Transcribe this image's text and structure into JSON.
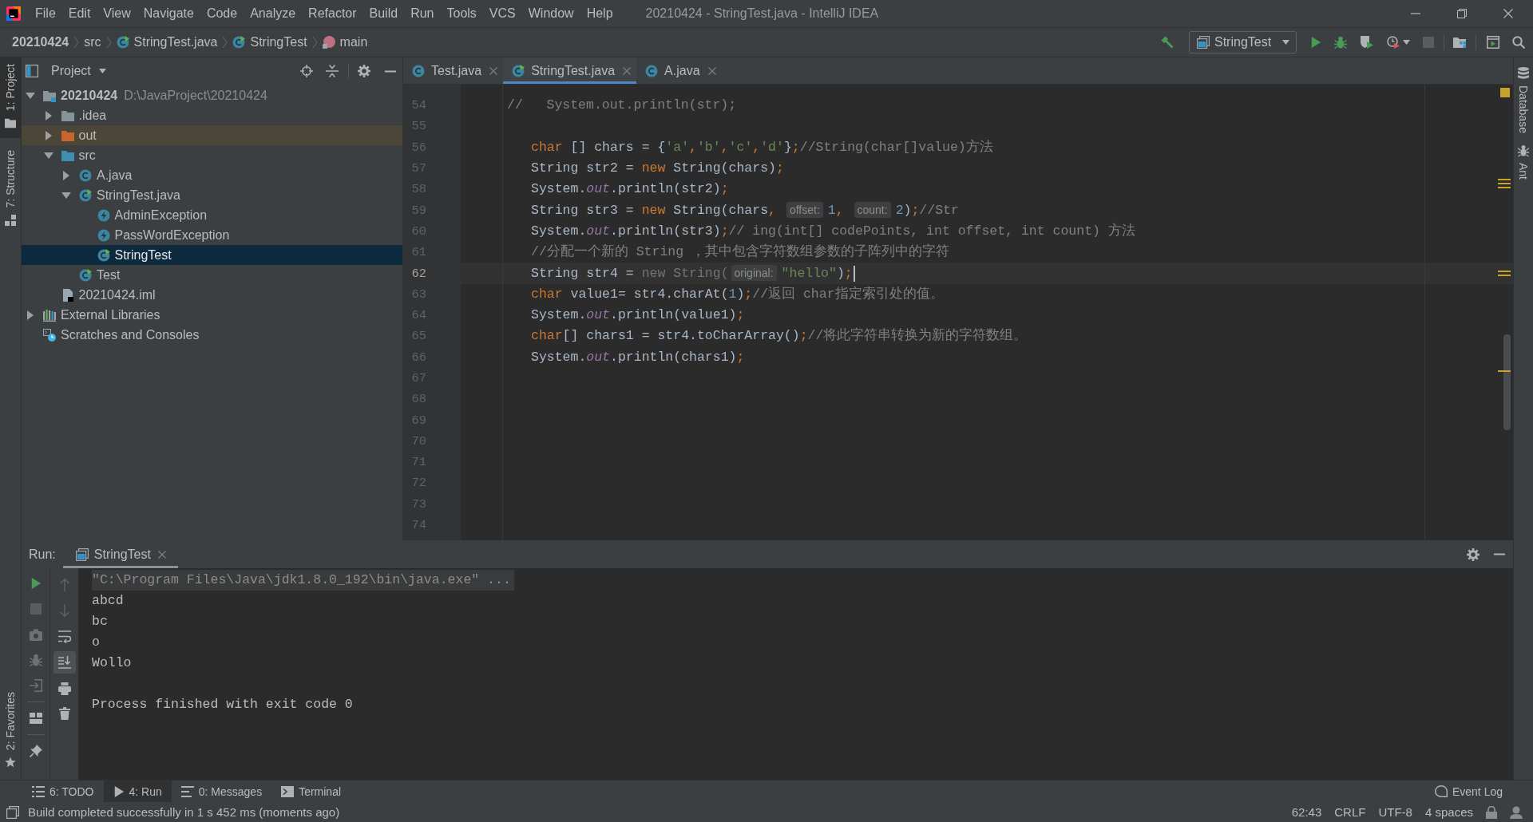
{
  "window": {
    "title": "20210424 - StringTest.java - IntelliJ IDEA"
  },
  "menu": [
    "File",
    "Edit",
    "View",
    "Navigate",
    "Code",
    "Analyze",
    "Refactor",
    "Build",
    "Run",
    "Tools",
    "VCS",
    "Window",
    "Help"
  ],
  "breadcrumbs": [
    {
      "label": "20210424",
      "kind": "project"
    },
    {
      "label": "src",
      "kind": "folder"
    },
    {
      "label": "StringTest.java",
      "kind": "runnable_class"
    },
    {
      "label": "StringTest",
      "kind": "runnable_class"
    },
    {
      "label": "main",
      "kind": "method"
    }
  ],
  "toolbar": {
    "run_configuration": "StringTest"
  },
  "left_stripe": {
    "top": [
      {
        "label": "1: Project",
        "kind": "project",
        "selected": true
      },
      {
        "label": "7: Structure",
        "kind": "structure",
        "selected": false
      }
    ],
    "bottom": [
      {
        "label": "2: Favorites",
        "kind": "favorites",
        "selected": false
      }
    ]
  },
  "right_stripe": [
    {
      "label": "Database",
      "kind": "database"
    },
    {
      "label": "Ant",
      "kind": "ant"
    }
  ],
  "project_panel": {
    "title": "Project",
    "tree": [
      {
        "label": "20210424",
        "path": "D:\\JavaProject\\20210424",
        "kind": "module",
        "expanded": true,
        "selected": false,
        "children": [
          {
            "label": ".idea",
            "kind": "folder",
            "expanded": false,
            "selected": false
          },
          {
            "label": "out",
            "kind": "excluded_folder",
            "expanded": false,
            "selected": false
          },
          {
            "label": "src",
            "kind": "source_folder",
            "expanded": true,
            "selected": false,
            "children": [
              {
                "label": "A.java",
                "kind": "class",
                "expanded": false,
                "selected": false
              },
              {
                "label": "StringTest.java",
                "kind": "runnable_class",
                "expanded": true,
                "selected": false,
                "children": [
                  {
                    "label": "AdminException",
                    "kind": "exception",
                    "selected": false
                  },
                  {
                    "label": "PassWordException",
                    "kind": "exception",
                    "selected": false
                  },
                  {
                    "label": "StringTest",
                    "kind": "runnable_class",
                    "selected": true
                  }
                ]
              },
              {
                "label": "Test",
                "kind": "runnable_class",
                "selected": false
              }
            ]
          },
          {
            "label": "20210424.iml",
            "kind": "module_file",
            "selected": false
          }
        ]
      },
      {
        "label": "External Libraries",
        "kind": "libraries",
        "expanded": false,
        "selected": false
      },
      {
        "label": "Scratches and Consoles",
        "kind": "scratches",
        "selected": false
      }
    ]
  },
  "editor": {
    "tabs": [
      {
        "label": "Test.java",
        "kind": "class",
        "selected": false
      },
      {
        "label": "StringTest.java",
        "kind": "runnable_class",
        "selected": true
      },
      {
        "label": "A.java",
        "kind": "class",
        "selected": false
      }
    ],
    "lines": [
      {
        "number": "54",
        "current": false,
        "kind": "commented",
        "tokens": [
          {
            "text": "//   System.out.println(str);",
            "kind": "comment"
          }
        ]
      },
      {
        "number": "55",
        "current": false
      },
      {
        "number": "56",
        "current": false,
        "kind": "code",
        "tokens": [
          {
            "text": "char",
            "kind": "keyword"
          },
          {
            "text": " [] chars = {",
            "kind": "plain"
          },
          {
            "text": "'a'",
            "kind": "string"
          },
          {
            "text": ",",
            "kind": "punct"
          },
          {
            "text": "'b'",
            "kind": "string"
          },
          {
            "text": ",",
            "kind": "punct"
          },
          {
            "text": "'c'",
            "kind": "string"
          },
          {
            "text": ",",
            "kind": "punct"
          },
          {
            "text": "'d'",
            "kind": "string"
          },
          {
            "text": "}",
            "kind": "plain"
          },
          {
            "text": ";",
            "kind": "punct"
          },
          {
            "text": "//String(char[]value)方法",
            "kind": "comment"
          }
        ]
      },
      {
        "number": "57",
        "current": false,
        "kind": "code",
        "tokens": [
          {
            "text": "String str2 = ",
            "kind": "plain"
          },
          {
            "text": "new",
            "kind": "keyword"
          },
          {
            "text": " String(chars)",
            "kind": "plain"
          },
          {
            "text": ";",
            "kind": "punct"
          }
        ]
      },
      {
        "number": "58",
        "current": false,
        "kind": "code",
        "tokens": [
          {
            "text": "System.",
            "kind": "plain"
          },
          {
            "text": "out",
            "kind": "field"
          },
          {
            "text": ".println(str2)",
            "kind": "plain"
          },
          {
            "text": ";",
            "kind": "punct"
          }
        ]
      },
      {
        "number": "59",
        "current": false,
        "kind": "code",
        "tokens": [
          {
            "text": "String str3 = ",
            "kind": "plain"
          },
          {
            "text": "new",
            "kind": "keyword"
          },
          {
            "text": " String(chars",
            "kind": "plain"
          },
          {
            "text": ", ",
            "kind": "punct"
          },
          {
            "text": "offset:",
            "kind": "hint"
          },
          {
            "text": "1",
            "kind": "number"
          },
          {
            "text": ", ",
            "kind": "punct"
          },
          {
            "text": "count:",
            "kind": "hint"
          },
          {
            "text": "2",
            "kind": "number"
          },
          {
            "text": ")",
            "kind": "plain"
          },
          {
            "text": ";",
            "kind": "punct"
          },
          {
            "text": "//Str",
            "kind": "comment"
          }
        ]
      },
      {
        "number": "60",
        "current": false,
        "kind": "code",
        "tokens": [
          {
            "text": "System.",
            "kind": "plain"
          },
          {
            "text": "out",
            "kind": "field"
          },
          {
            "text": ".println(str3)",
            "kind": "plain"
          },
          {
            "text": ";",
            "kind": "punct"
          },
          {
            "text": "// ing(int[] codePoints, int offset, int count) 方法",
            "kind": "comment"
          }
        ]
      },
      {
        "number": "61",
        "current": false,
        "kind": "code",
        "tokens": [
          {
            "text": "//分配一个新的 String ，其中包含字符数组参数的子阵列中的字符",
            "kind": "comment"
          }
        ]
      },
      {
        "number": "62",
        "current": true,
        "kind": "code",
        "tokens": [
          {
            "text": "String str4 = ",
            "kind": "plain"
          },
          {
            "text": "new String(",
            "kind": "unused"
          },
          {
            "text": "original:",
            "kind": "hint"
          },
          {
            "text": "\"hello\"",
            "kind": "string"
          },
          {
            "text": ")",
            "kind": "plain"
          },
          {
            "text": ";",
            "kind": "punct"
          }
        ]
      },
      {
        "number": "63",
        "current": false,
        "kind": "code",
        "tokens": [
          {
            "text": "char",
            "kind": "keyword"
          },
          {
            "text": " value1= str4.charAt(",
            "kind": "plain"
          },
          {
            "text": "1",
            "kind": "number"
          },
          {
            "text": ")",
            "kind": "plain"
          },
          {
            "text": ";",
            "kind": "punct"
          },
          {
            "text": "//返回 char指定索引处的值。",
            "kind": "comment"
          }
        ]
      },
      {
        "number": "64",
        "current": false,
        "kind": "code",
        "tokens": [
          {
            "text": "System.",
            "kind": "plain"
          },
          {
            "text": "out",
            "kind": "field"
          },
          {
            "text": ".println(value1)",
            "kind": "plain"
          },
          {
            "text": ";",
            "kind": "punct"
          }
        ]
      },
      {
        "number": "65",
        "current": false,
        "kind": "code",
        "tokens": [
          {
            "text": "char",
            "kind": "keyword"
          },
          {
            "text": "[] chars1 = str4.toCharArray()",
            "kind": "plain"
          },
          {
            "text": ";",
            "kind": "punct"
          },
          {
            "text": "//将此字符串转换为新的字符数组。",
            "kind": "comment"
          }
        ]
      },
      {
        "number": "66",
        "current": false,
        "kind": "code",
        "tokens": [
          {
            "text": "System.",
            "kind": "plain"
          },
          {
            "text": "out",
            "kind": "field"
          },
          {
            "text": ".println(chars1)",
            "kind": "plain"
          },
          {
            "text": ";",
            "kind": "punct"
          }
        ]
      },
      {
        "number": "67",
        "current": false
      },
      {
        "number": "68",
        "current": false
      },
      {
        "number": "69",
        "current": false
      },
      {
        "number": "70",
        "current": false
      },
      {
        "number": "71",
        "current": false
      },
      {
        "number": "72",
        "current": false
      },
      {
        "number": "73",
        "current": false
      },
      {
        "number": "74",
        "current": false
      }
    ]
  },
  "run_panel": {
    "label": "Run:",
    "tabs": [
      {
        "label": "StringTest",
        "selected": true
      }
    ],
    "console": [
      {
        "text": "\"C:\\Program Files\\Java\\jdk1.8.0_192\\bin\\java.exe\" ...",
        "kind": "command"
      },
      {
        "text": "abcd",
        "kind": "output"
      },
      {
        "text": "bc",
        "kind": "output"
      },
      {
        "text": "o",
        "kind": "output"
      },
      {
        "text": "Wollo",
        "kind": "output"
      },
      {
        "text": "Process finished with exit code 0",
        "kind": "exit"
      }
    ]
  },
  "tool_window_bar": {
    "left": [
      {
        "label": "6: TODO",
        "kind": "todo",
        "selected": false
      },
      {
        "label": "4: Run",
        "kind": "run",
        "selected": true
      },
      {
        "label": "0: Messages",
        "kind": "messages",
        "selected": false
      },
      {
        "label": "Terminal",
        "kind": "terminal",
        "selected": false
      }
    ],
    "right": [
      {
        "label": "Event Log",
        "kind": "event_log"
      }
    ]
  },
  "status_bar": {
    "message": "Build completed successfully in 1 s 452 ms (moments ago)",
    "caret_position": "62:43",
    "line_separator": "CRLF",
    "encoding": "UTF-8",
    "indent": "4 spaces"
  }
}
